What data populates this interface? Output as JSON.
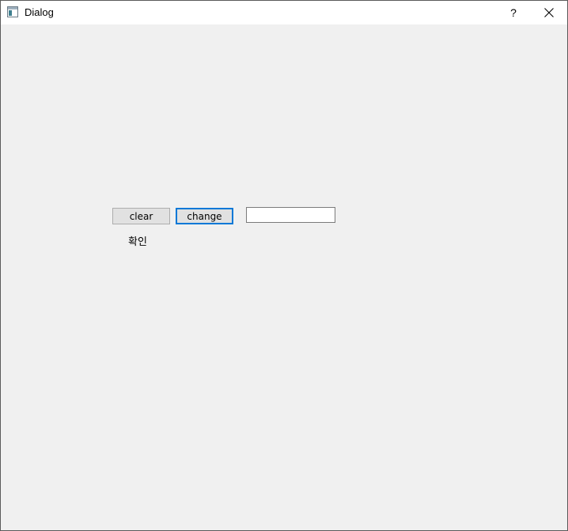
{
  "window": {
    "title": "Dialog",
    "help_label": "?"
  },
  "buttons": {
    "clear_label": "clear",
    "change_label": "change"
  },
  "text_field": {
    "value": ""
  },
  "label": {
    "text": "확인"
  },
  "icons": {
    "app": "app-window-icon",
    "close": "close-icon"
  },
  "colors": {
    "focus_border": "#0078d7",
    "dialog_background": "#f0f0f0",
    "titlebar_background": "#ffffff"
  }
}
